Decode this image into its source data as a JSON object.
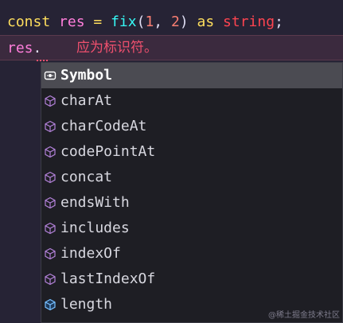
{
  "editor": {
    "line1": {
      "kw_const": "const",
      "var": "res",
      "eq": "=",
      "fn": "fix",
      "paren_open": "(",
      "arg1": "1",
      "comma": ",",
      "arg2": "2",
      "paren_close": ")",
      "kw_as": "as",
      "type": "string",
      "semi": ";"
    },
    "line2": {
      "var": "res",
      "dot": "."
    },
    "error_message": "应为标识符。"
  },
  "suggestions": {
    "items": [
      {
        "label": "Symbol",
        "icon": "symbol-field-icon",
        "selected": true
      },
      {
        "label": "charAt",
        "icon": "method-cube-icon"
      },
      {
        "label": "charCodeAt",
        "icon": "method-cube-icon"
      },
      {
        "label": "codePointAt",
        "icon": "method-cube-icon"
      },
      {
        "label": "concat",
        "icon": "method-cube-icon"
      },
      {
        "label": "endsWith",
        "icon": "method-cube-icon"
      },
      {
        "label": "includes",
        "icon": "method-cube-icon"
      },
      {
        "label": "indexOf",
        "icon": "method-cube-icon"
      },
      {
        "label": "lastIndexOf",
        "icon": "method-cube-icon"
      },
      {
        "label": "length",
        "icon": "property-cube-icon"
      }
    ]
  },
  "watermark": "@稀土掘金技术社区",
  "colors": {
    "background": "#262335",
    "keyword": "#fede5d",
    "variable": "#ff7edb",
    "function": "#36f9f6",
    "number": "#f97e72",
    "type": "#fe4450",
    "error": "#f0506e",
    "method_icon": "#b180d7",
    "property_icon": "#75beff"
  }
}
